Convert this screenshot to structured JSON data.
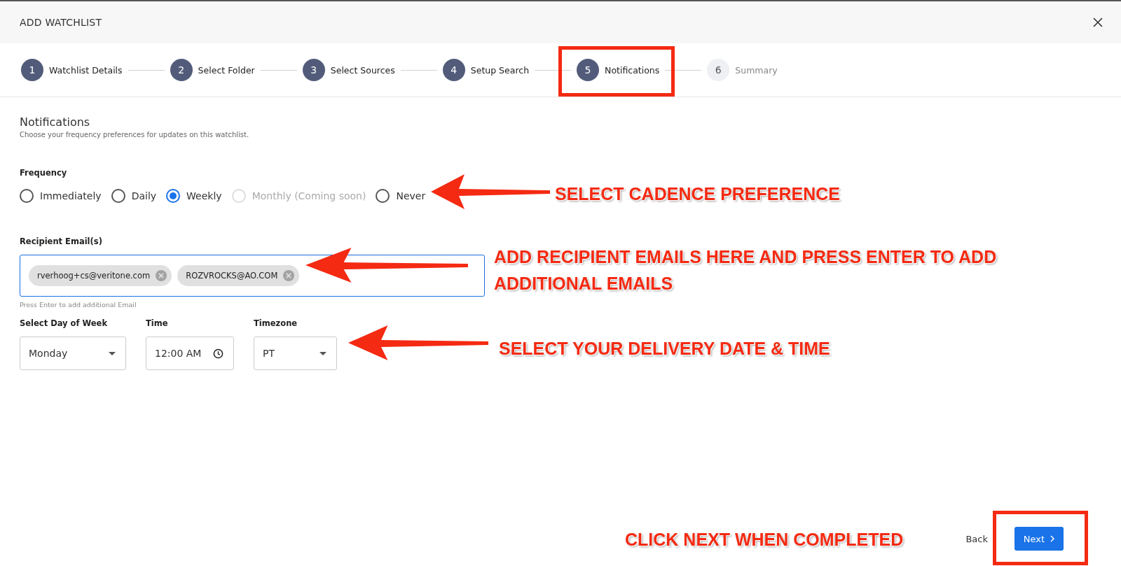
{
  "dialog": {
    "title": "ADD WATCHLIST"
  },
  "steps": [
    {
      "number": "1",
      "label": "Watchlist Details",
      "active": true
    },
    {
      "number": "2",
      "label": "Select Folder",
      "active": true
    },
    {
      "number": "3",
      "label": "Select Sources",
      "active": true
    },
    {
      "number": "4",
      "label": "Setup Search",
      "active": true
    },
    {
      "number": "5",
      "label": "Notifications",
      "active": true
    },
    {
      "number": "6",
      "label": "Summary",
      "active": false
    }
  ],
  "section": {
    "title": "Notifications",
    "subtitle": "Choose your frequency preferences for updates on this watchlist."
  },
  "frequency": {
    "label": "Frequency",
    "options": [
      {
        "label": "Immediately",
        "selected": false,
        "disabled": false
      },
      {
        "label": "Daily",
        "selected": false,
        "disabled": false
      },
      {
        "label": "Weekly",
        "selected": true,
        "disabled": false
      },
      {
        "label": "Monthly (Coming soon)",
        "selected": false,
        "disabled": true
      },
      {
        "label": "Never",
        "selected": false,
        "disabled": false
      }
    ]
  },
  "recipients": {
    "label": "Recipient Email(s)",
    "emails": [
      "rverhoog+cs@veritone.com",
      "ROZVROCKS@AO.COM"
    ],
    "hint": "Press Enter to add additional Email"
  },
  "schedule": [
    {
      "kind": "select",
      "label": "Select Day of Week",
      "value": "Monday"
    },
    {
      "kind": "time",
      "label": "Time",
      "value": "12:00 AM"
    },
    {
      "kind": "select",
      "label": "Timezone",
      "value": "PT"
    }
  ],
  "footer": {
    "back": "Back",
    "next": "Next"
  },
  "annotations": [
    {
      "kind": "box"
    },
    {
      "kind": "arrow"
    },
    {
      "kind": "callout",
      "text": "SELECT CADENCE PREFERENCE"
    },
    {
      "kind": "arrow"
    },
    {
      "kind": "callout",
      "text": "ADD RECIPIENT EMAILS HERE AND PRESS ENTER TO ADD ADDITIONAL EMAILS"
    },
    {
      "kind": "arrow"
    },
    {
      "kind": "callout",
      "text": "SELECT YOUR DELIVERY DATE & TIME"
    },
    {
      "kind": "callout",
      "text": "CLICK NEXT WHEN COMPLETED"
    },
    {
      "kind": "box"
    }
  ]
}
